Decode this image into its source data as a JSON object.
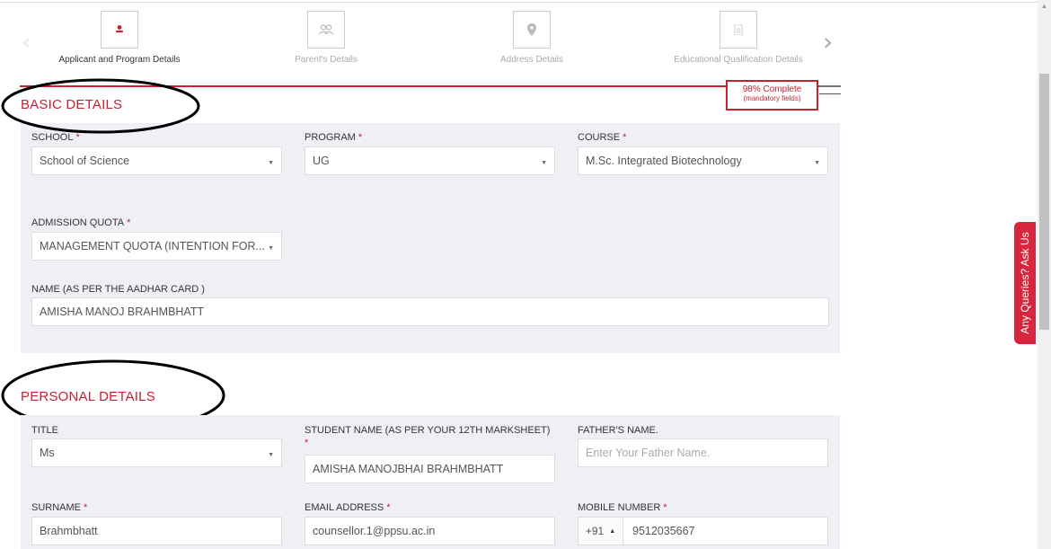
{
  "stepper": {
    "steps": [
      {
        "label": "Applicant and Program Details",
        "icon": "user-icon",
        "active": true
      },
      {
        "label": "Parent's Details",
        "icon": "parents-icon",
        "active": false
      },
      {
        "label": "Address Details",
        "icon": "map-pin-icon",
        "active": false
      },
      {
        "label": "Educational Qualification Details",
        "icon": "document-icon",
        "active": false
      }
    ],
    "progress": {
      "percent_label": "98% Complete",
      "sub_label": "(mandatory fields)",
      "value": 98
    }
  },
  "basic": {
    "title": "BASIC DETAILS",
    "school": {
      "label": "SCHOOL",
      "value": "School of Science"
    },
    "program": {
      "label": "PROGRAM",
      "value": "UG"
    },
    "course": {
      "label": "COURSE",
      "value": "M.Sc. Integrated Biotechnology"
    },
    "quota": {
      "label": "ADMISSION QUOTA",
      "value": "MANAGEMENT QUOTA (INTENTION FOR..."
    },
    "name": {
      "label": "NAME (AS PER THE AADHAR CARD )",
      "value": "AMISHA MANOJ BRAHMBHATT"
    }
  },
  "personal": {
    "title": "PERSONAL DETAILS",
    "title_field": {
      "label": "TITLE",
      "value": "Ms"
    },
    "student_name": {
      "label": "STUDENT NAME (AS PER YOUR 12TH MARKSHEET)",
      "value": "AMISHA MANOJBHAI BRAHMBHATT"
    },
    "father_name": {
      "label": "FATHER'S NAME.",
      "placeholder": "Enter Your Father Name."
    },
    "surname": {
      "label": "SURNAME",
      "value": "Brahmbhatt"
    },
    "email": {
      "label": "EMAIL ADDRESS",
      "value": "counsellor.1@ppsu.ac.in"
    },
    "mobile": {
      "label": "MOBILE NUMBER",
      "code": "+91",
      "value": "9512035667"
    }
  },
  "side_tab": {
    "label": "Any Queries? Ask Us"
  },
  "colors": {
    "accent": "#c8202f",
    "panel": "#eef0f6",
    "side_tab": "#d7263d"
  }
}
